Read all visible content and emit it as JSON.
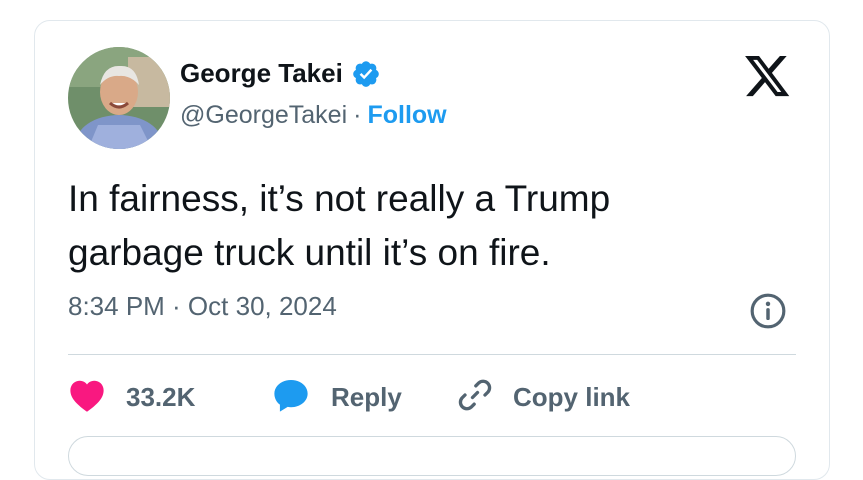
{
  "tweet": {
    "author_name": "George Takei",
    "handle": "@GeorgeTakei",
    "separator": "·",
    "follow_label": "Follow",
    "text_line1": "In fairness, it’s not really a Trump",
    "text_line2": "garbage truck until it’s on fire.",
    "timestamp": "8:34 PM · Oct 30, 2024",
    "verified": true
  },
  "actions": {
    "like_count": "33.2K",
    "reply_label": "Reply",
    "copy_link_label": "Copy link"
  },
  "icons": {
    "verified": "verified-badge-icon",
    "x_logo": "x-logo-icon",
    "info": "info-icon",
    "heart": "heart-icon",
    "reply": "speech-bubble-icon",
    "link": "link-icon"
  },
  "colors": {
    "accent": "#1d9bf0",
    "like": "#f91880",
    "text": "#0f1419",
    "secondary": "#536471",
    "border": "#cfd9de"
  }
}
